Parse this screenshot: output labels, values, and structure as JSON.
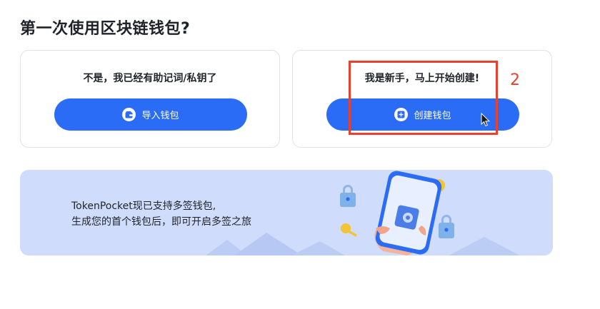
{
  "page": {
    "title": "第一次使用区块链钱包?"
  },
  "cards": {
    "import": {
      "text": "不是，我已经有助记词/私钥了",
      "button_label": "导入钱包",
      "icon": "wallet-icon"
    },
    "create": {
      "text": "我是新手，马上开始创建!",
      "button_label": "创建钱包",
      "icon": "plus-icon"
    }
  },
  "banner": {
    "line1": "TokenPocket现已支持多签钱包,",
    "line2": "生成您的首个钱包后，即可开启多签之旅",
    "illustration": "hand-holding-phone-with-locks-and-keys"
  },
  "annotation": {
    "number": "2",
    "color": "#e8412f"
  },
  "colors": {
    "accent": "#2a6cf5",
    "banner_bg": "#cfdcfb"
  }
}
